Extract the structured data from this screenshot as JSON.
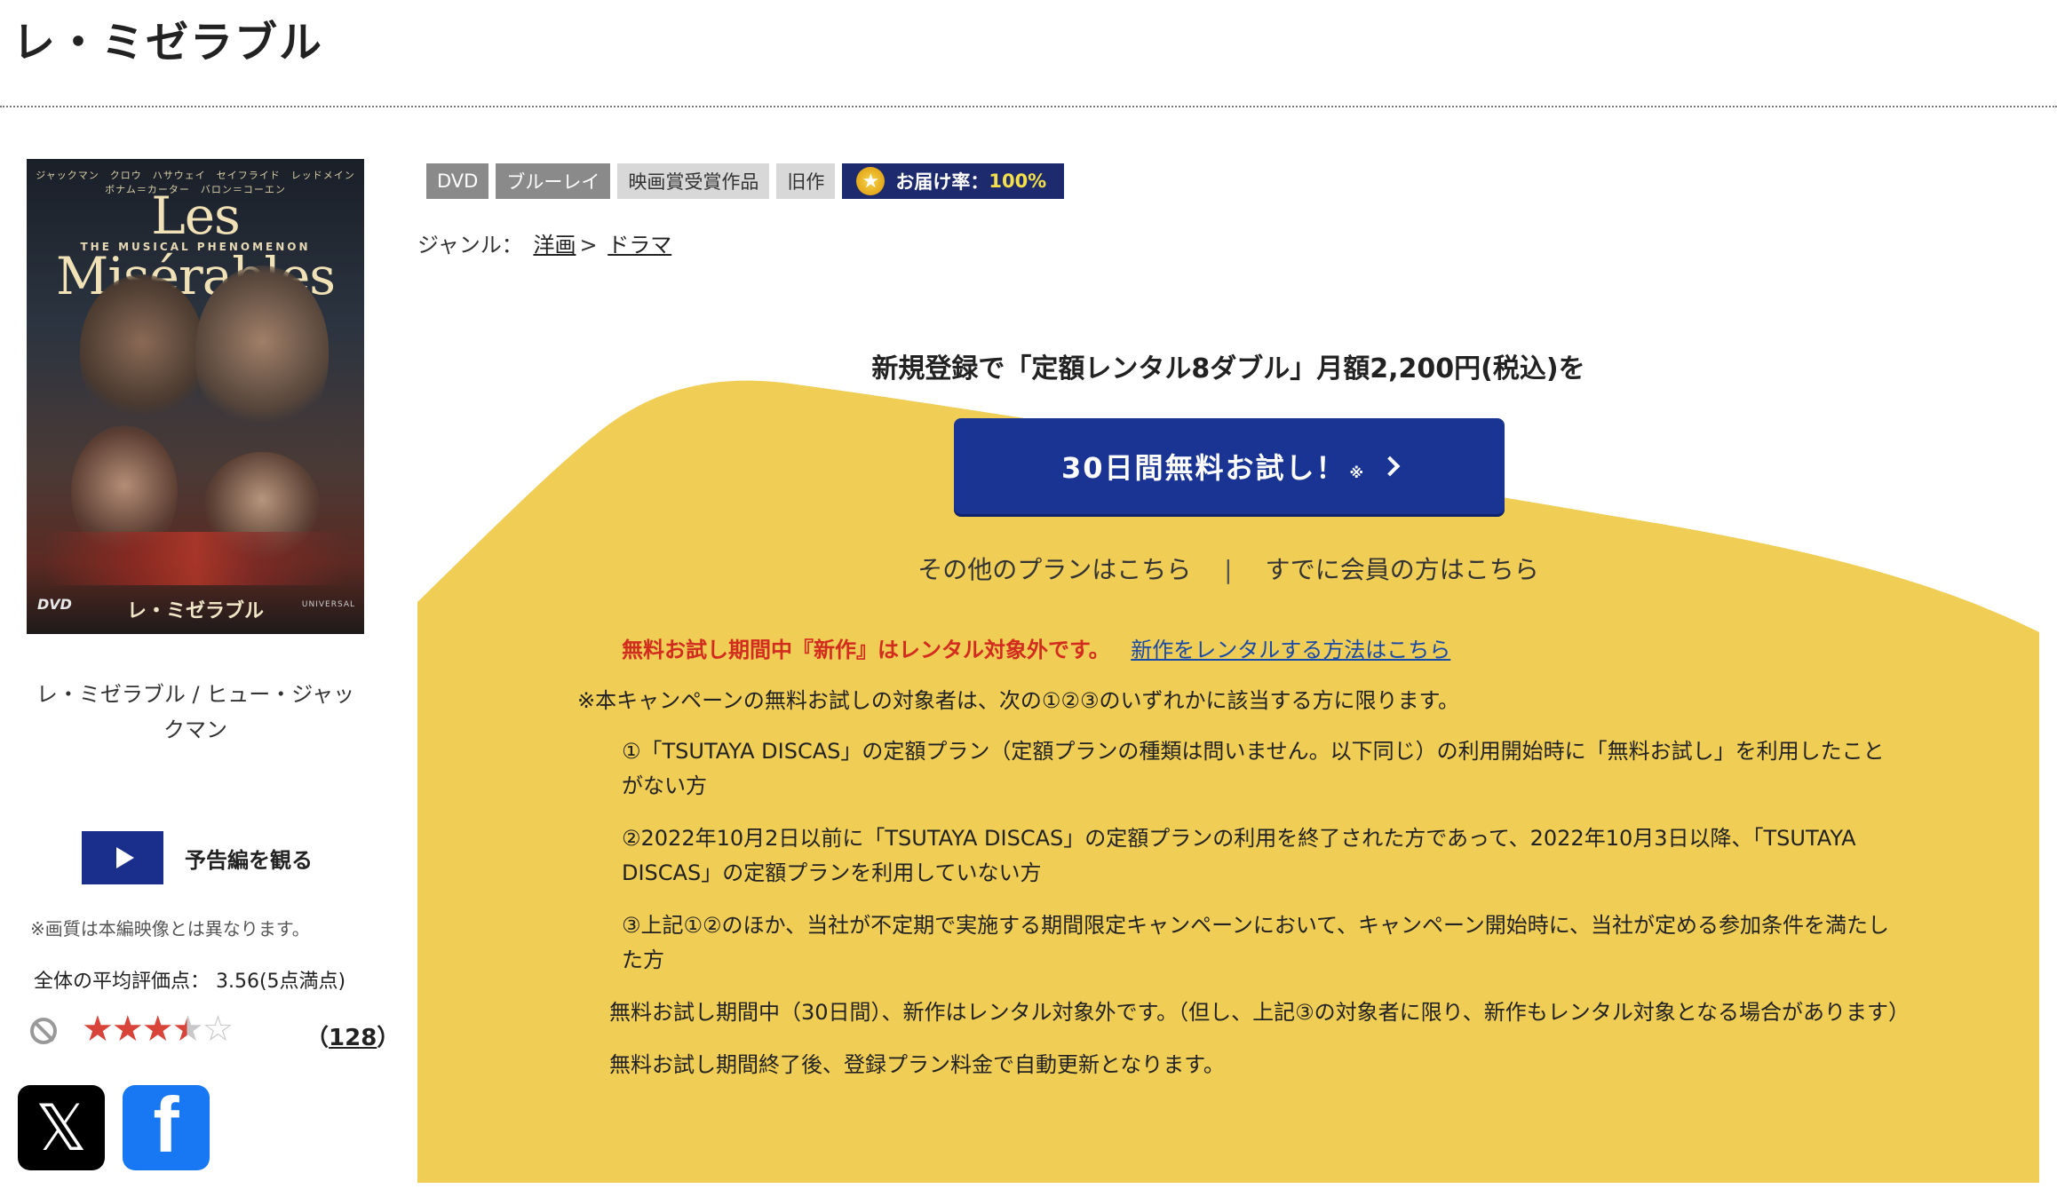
{
  "page": {
    "title": "レ・ミゼラブル"
  },
  "poster": {
    "cast_line": "ジャックマン　クロウ　ハサウェイ　セイフライド　レッドメイン　ボナム＝カーター　バロン＝コーエン",
    "title_en": "Les Misérables",
    "subtitle_en": "THE MUSICAL PHENOMENON",
    "title_jp": "レ・ミゼラブル",
    "dvd_mark": "DVD",
    "studio": "UNIVERSAL"
  },
  "movie": {
    "caption": "レ・ミゼラブル / ヒュー・ジャックマン",
    "trailer_label": "予告編を観る",
    "quality_note": "※画質は本編映像とは異なります。",
    "avg_rating_text": "全体の平均評価点： 3.56(5点満点)",
    "rating_value": 3.56,
    "rating_max": 5,
    "review_count": "128",
    "review_paren_open": "（",
    "review_paren_close": "）"
  },
  "sns": {
    "x_icon": "x-logo",
    "x_glyph": "𝕏",
    "facebook_icon": "facebook-logo",
    "facebook_glyph": "f"
  },
  "tags": [
    {
      "label": "DVD",
      "style": "dark"
    },
    {
      "label": "ブルーレイ",
      "style": "dark"
    },
    {
      "label": "映画賞受賞作品",
      "style": "light"
    },
    {
      "label": "旧作",
      "style": "light"
    }
  ],
  "delivery_rate": {
    "label": "お届け率：",
    "value": "100%",
    "icon": "star-medal-icon",
    "glyph": "★"
  },
  "genre": {
    "label": "ジャンル：",
    "items": [
      "洋画",
      "ドラマ"
    ],
    "separator": ">"
  },
  "promo": {
    "heading": "新規登録で「定額レンタル8ダブル」月額2,200円(税込)を",
    "button_label": "30日間無料お試し！",
    "button_mark": "※",
    "other_plans": "その他のプランはこちら",
    "divider": "|",
    "members": "すでに会員の方はこちら",
    "warning": "無料お試し期間中『新作』はレンタル対象外です。",
    "warning_link": "新作をレンタルする方法はこちら",
    "note_lead": "※本キャンペーンの無料お試しの対象者は、次の①②③のいずれかに該当する方に限ります。",
    "note_items": [
      "①「TSUTAYA DISCAS」の定額プラン（定額プランの種類は問いません。以下同じ）の利用開始時に「無料お試し」を利用したことがない方",
      "②2022年10月2日以前に「TSUTAYA DISCAS」の定額プランの利用を終了された方であって、2022年10月3日以降、「TSUTAYA DISCAS」の定額プランを利用していない方",
      "③上記①②のほか、当社が不定期で実施する期間限定キャンペーンにおいて、キャンペーン開始時に、当社が定める参加条件を満たした方"
    ],
    "note_para1": "無料お試し期間中（30日間）、新作はレンタル対象外です。（但し、上記③の対象者に限り、新作もレンタル対象となる場合があります）",
    "note_para2": "無料お試し期間終了後、登録プラン料金で自動更新となります。"
  },
  "colors": {
    "panel_yellow": "#f0cd55",
    "button_blue": "#1a3494",
    "warning_red": "#d22c1f",
    "link_blue": "#1a4aa8",
    "rate_badge": "#1e2a6e"
  }
}
